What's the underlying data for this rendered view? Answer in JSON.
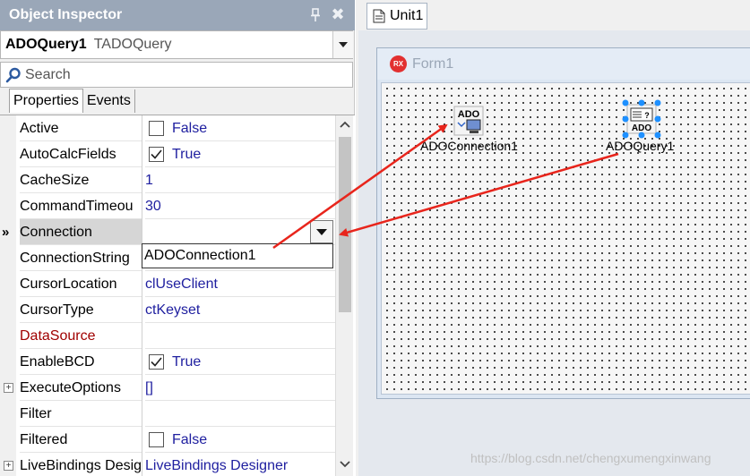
{
  "inspector": {
    "title": "Object Inspector",
    "selected_name": "ADOQuery1",
    "selected_type": "TADOQuery",
    "search_placeholder": "Search",
    "tabs": [
      {
        "label": "Properties",
        "active": true
      },
      {
        "label": "Events",
        "active": false
      }
    ],
    "properties": [
      {
        "name": "Active",
        "value": "False",
        "kind": "check",
        "checked": false
      },
      {
        "name": "AutoCalcFields",
        "value": "True",
        "kind": "check",
        "checked": true
      },
      {
        "name": "CacheSize",
        "value": "1",
        "kind": "text"
      },
      {
        "name": "CommandTimeou",
        "value": "30",
        "kind": "text"
      },
      {
        "name": "Connection",
        "value": "",
        "kind": "dropdown",
        "selected": true
      },
      {
        "name": "ConnectionString",
        "value": "",
        "kind": "text"
      },
      {
        "name": "CursorLocation",
        "value": "clUseClient",
        "kind": "text"
      },
      {
        "name": "CursorType",
        "value": "ctKeyset",
        "kind": "text"
      },
      {
        "name": "DataSource",
        "value": "",
        "kind": "text",
        "highlight": true
      },
      {
        "name": "EnableBCD",
        "value": "True",
        "kind": "check",
        "checked": true
      },
      {
        "name": "ExecuteOptions",
        "value": "[]",
        "kind": "text",
        "expandable": true
      },
      {
        "name": "Filter",
        "value": "",
        "kind": "text"
      },
      {
        "name": "Filtered",
        "value": "False",
        "kind": "check",
        "checked": false
      },
      {
        "name": "LiveBindings Desig",
        "value": "LiveBindings Designer",
        "kind": "text",
        "expandable": true
      }
    ],
    "edit_value": "ADOConnection1",
    "selected_marker": "»"
  },
  "designer": {
    "tab_label": "Unit1",
    "form_caption": "Form1",
    "form_logo": "RX",
    "components": [
      {
        "label": "ADOConnection1",
        "icon": "ado-connection-icon",
        "icon_text": "ADO"
      },
      {
        "label": "ADOQuery1",
        "icon": "ado-query-icon",
        "icon_text": "ADO"
      }
    ]
  },
  "watermark": "https://blog.csdn.net/chengxumengxinwang",
  "colors": {
    "title_bar": "#9aa7b8",
    "value_text": "#2020a0",
    "highlight_name": "#a00000",
    "arrow": "#e8251c"
  }
}
